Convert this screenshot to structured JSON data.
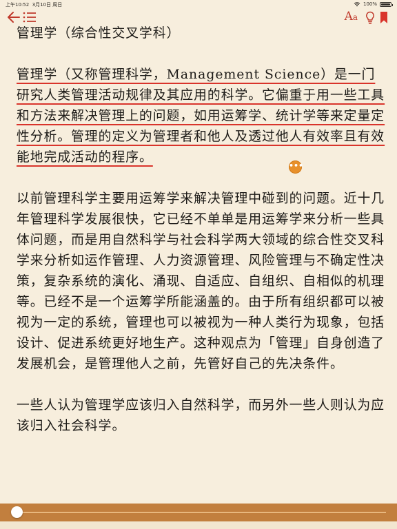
{
  "status_bar": {
    "time": "上午10:52",
    "date": "3月10日 周日",
    "battery": "100%",
    "battery_level": 1.0,
    "wifi_icon": "wifi-icon"
  },
  "toolbar": {
    "back_icon": "back-arrow-icon",
    "toc_icon": "list-icon",
    "font_label_large": "A",
    "font_label_small": "a",
    "bulb_icon": "light-bulb-icon",
    "bookmark_icon": "bookmark-icon",
    "accent_color": "#c0392b"
  },
  "content": {
    "heading": "管理学（综合性交叉学科）",
    "para1_highlighted": "管理学（又称管理科学，Management Science）是一门研究人类管理活动规律及其应用的科学。它偏重于用一些工具和方法来解决管理上的问题，如用运筹学、统计学等来定量定性分析。管理的定义为管理者和他人及透过他人有效率且有效能地完成活动的程序。",
    "note_badge": "•••",
    "para2": "以前管理科学主要用运筹学来解决管理中碰到的问题。近十几年管理科学发展很快，它已经不单单是用运筹学来分析一些具体问题，而是用自然科学与社会科学两大领域的综合性交叉科学来分析如运作管理、人力资源管理、风险管理与不确定性决策，复杂系统的演化、涌现、自适应、自组织、自相似的机理等。已经不是一个运筹学所能涵盖的。由于所有组织都可以被视为一定的系统，管理也可以被视为一种人类行为现象，包括设计、促进系统更好地生产。这种观点为「管理」自身创造了发展机会，是管理他人之前，先管好自己的先决条件。",
    "para3": "一些人认为管理学应该归入自然科学，而另外一些人则认为应该归入社会科学。",
    "highlight_color": "#d9342b"
  },
  "progress": {
    "value": 0.0,
    "bar_color": "#c27f3e"
  }
}
